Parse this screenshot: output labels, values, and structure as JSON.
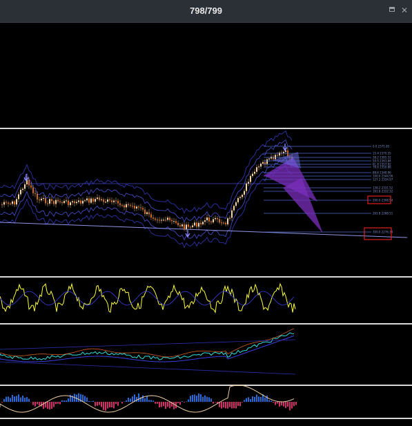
{
  "window": {
    "title": "798/799",
    "maximize_icon": "maximize-icon",
    "close_icon": "close-icon"
  },
  "chart": {
    "background": "#000000",
    "candle_up": "#f5d6a0",
    "candle_down": "#d2691e",
    "pattern_color": "#7b2fbe",
    "oscillator_color": "#ffff33",
    "highlight_box_color": "#e02020",
    "level_labels": [
      "0.0 2371.85",
      "15.4 2370.55",
      "38.2 2365.52",
      "50.0 2361.84",
      "61.8 2357.92",
      "78.6 2350.86",
      "88.6 2348.96",
      "100.0 2344.56",
      "127.2 2334.97",
      "138.2 2331.52",
      "161.8 2322.32",
      "200.0 2308.94",
      "261.8 2288.51",
      "300.0 2276.34"
    ]
  }
}
